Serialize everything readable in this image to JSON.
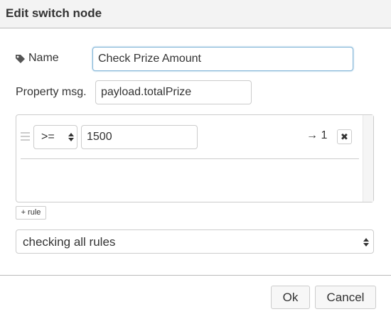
{
  "dialog": {
    "title": "Edit switch node"
  },
  "form": {
    "name_label": "Name",
    "name_value": "Check Prize Amount",
    "property_label": "Property msg.",
    "property_value": "payload.totalPrize"
  },
  "rules": [
    {
      "operator": ">=",
      "value": "1500",
      "output": "→ 1",
      "remove_icon": "✖"
    }
  ],
  "add_rule_label": "+ rule",
  "checking_mode": "checking all rules",
  "buttons": {
    "ok": "Ok",
    "cancel": "Cancel"
  },
  "icons": {
    "name": "tag-icon",
    "drag": "drag-handle-icon",
    "remove": "close-icon",
    "select": "updown-arrow-icon"
  },
  "colors": {
    "focus_border": "#85b7d9",
    "title_bg": "#f3f3f3"
  }
}
